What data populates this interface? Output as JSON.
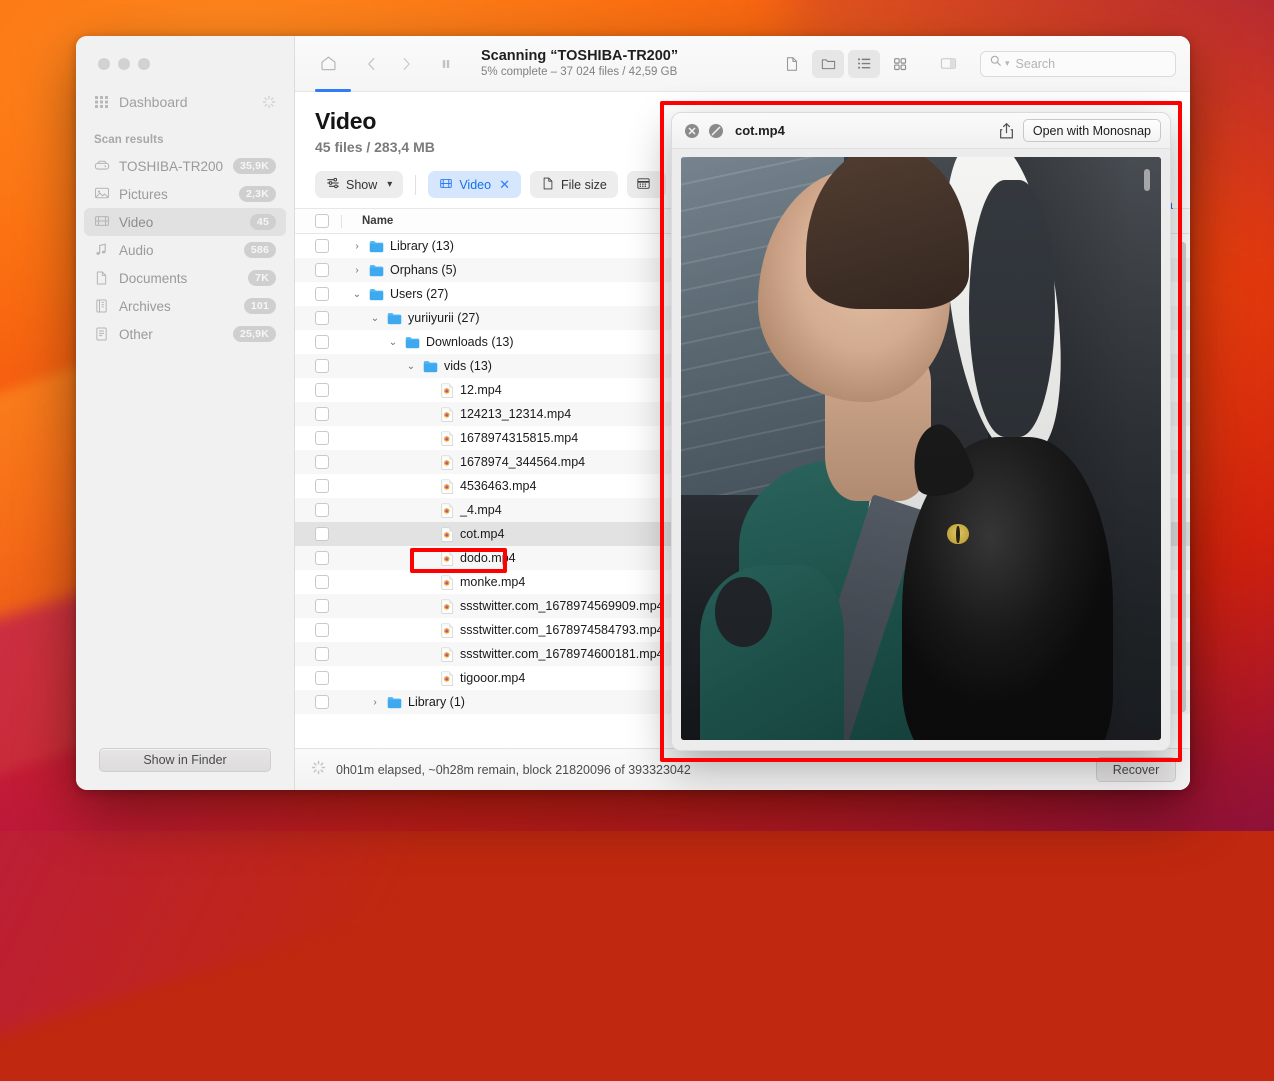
{
  "window": {
    "traffic_lights": [
      "close",
      "minimize",
      "zoom"
    ]
  },
  "sidebar": {
    "dashboard": {
      "label": "Dashboard",
      "icon": "grid-icon",
      "busy_icon": "spinner-icon"
    },
    "section_title": "Scan results",
    "items": [
      {
        "label": "TOSHIBA-TR200",
        "badge": "35,9K",
        "icon": "disk-icon",
        "selected": false
      },
      {
        "label": "Pictures",
        "badge": "2,3K",
        "icon": "image-icon",
        "selected": false
      },
      {
        "label": "Video",
        "badge": "45",
        "icon": "film-icon",
        "selected": true
      },
      {
        "label": "Audio",
        "badge": "586",
        "icon": "music-note-icon",
        "selected": false
      },
      {
        "label": "Documents",
        "badge": "7K",
        "icon": "document-icon",
        "selected": false
      },
      {
        "label": "Archives",
        "badge": "101",
        "icon": "archive-icon",
        "selected": false
      },
      {
        "label": "Other",
        "badge": "25,9K",
        "icon": "other-file-icon",
        "selected": false
      }
    ],
    "footer_button": "Show in Finder"
  },
  "toolbar": {
    "home_icon": "home-icon",
    "back_icon": "chevron-left-icon",
    "forward_icon": "chevron-right-icon",
    "pause_icon": "pause-icon",
    "scan_title": "Scanning “TOSHIBA-TR200”",
    "scan_subtitle": "5% complete – 37 024 files / 42,59 GB",
    "view_buttons": [
      {
        "name": "preview-pane-toggle",
        "icon": "document-icon",
        "active": false
      },
      {
        "name": "folder-view-toggle",
        "icon": "folder-icon",
        "active": true
      },
      {
        "name": "list-view-toggle",
        "icon": "list-icon",
        "active": true
      },
      {
        "name": "grid-view-toggle",
        "icon": "grid-icon",
        "active": false
      },
      {
        "name": "sidebar-pane-toggle",
        "icon": "panel-icon",
        "active": false
      }
    ],
    "search_placeholder": "Search",
    "search_value": "",
    "search_icon": "search-icon"
  },
  "page": {
    "title": "Video",
    "subtitle": "45 files / 283,4 MB"
  },
  "filters": {
    "show": {
      "label": "Show",
      "icon": "sliders-icon",
      "chevron": "chevron-down-icon"
    },
    "chips": [
      {
        "label": "Video",
        "icon": "film-icon",
        "active": true,
        "removable": true,
        "remove_icon": "close-icon"
      },
      {
        "label": "File size",
        "icon": "document-icon",
        "active": false,
        "removable": false
      },
      {
        "label": "",
        "icon": "calendar-icon",
        "active": false,
        "removable": false
      }
    ]
  },
  "table": {
    "columns": [
      "",
      "Name"
    ],
    "rows": [
      {
        "name": "Library (13)",
        "type": "folder",
        "depth": 0,
        "expanded": false,
        "checked": false
      },
      {
        "name": "Orphans (5)",
        "type": "folder",
        "depth": 0,
        "expanded": false,
        "checked": false
      },
      {
        "name": "Users (27)",
        "type": "folder",
        "depth": 0,
        "expanded": true,
        "checked": false
      },
      {
        "name": "yuriiyurii (27)",
        "type": "folder",
        "depth": 1,
        "expanded": true,
        "checked": false
      },
      {
        "name": "Downloads (13)",
        "type": "folder",
        "depth": 2,
        "expanded": true,
        "checked": false
      },
      {
        "name": "vids (13)",
        "type": "folder",
        "depth": 3,
        "expanded": true,
        "checked": false
      },
      {
        "name": "12.mp4",
        "type": "file",
        "depth": 4,
        "checked": false
      },
      {
        "name": "124213_12314.mp4",
        "type": "file",
        "depth": 4,
        "checked": false
      },
      {
        "name": "1678974315815.mp4",
        "type": "file",
        "depth": 4,
        "checked": false
      },
      {
        "name": "1678974_344564.mp4",
        "type": "file",
        "depth": 4,
        "checked": false
      },
      {
        "name": "4536463.mp4",
        "type": "file",
        "depth": 4,
        "checked": false
      },
      {
        "name": "_4.mp4",
        "type": "file",
        "depth": 4,
        "checked": false
      },
      {
        "name": "cot.mp4",
        "type": "file",
        "depth": 4,
        "checked": false,
        "selected": true,
        "quicklook_icon": "eye-icon"
      },
      {
        "name": "dodo.mp4",
        "type": "file",
        "depth": 4,
        "checked": false
      },
      {
        "name": "monke.mp4",
        "type": "file",
        "depth": 4,
        "checked": false
      },
      {
        "name": "ssstwitter.com_1678974569909.mp4",
        "type": "file",
        "depth": 4,
        "checked": false
      },
      {
        "name": "ssstwitter.com_1678974584793.mp4",
        "type": "file",
        "depth": 4,
        "checked": false
      },
      {
        "name": "ssstwitter.com_1678974600181.mp4",
        "type": "file",
        "depth": 4,
        "checked": false
      },
      {
        "name": "tigooor.mp4",
        "type": "file",
        "depth": 4,
        "checked": false
      },
      {
        "name": "Library (1)",
        "type": "folder",
        "depth": 1,
        "expanded": false,
        "checked": false
      }
    ]
  },
  "peek_text": "a",
  "quicklook": {
    "close_icon": "close-circle-icon",
    "block_icon": "no-entry-circle-icon",
    "title": "cot.mp4",
    "share_icon": "share-icon",
    "open_button": "Open with Monosnap",
    "media_description": "Video still: man in green scrubs driving a car with a black cat perched on his shoulder"
  },
  "statusbar": {
    "spinner_icon": "spinner-icon",
    "text": "0h01m elapsed, ~0h28m remain, block 21820096 of 393323042",
    "recover_button": "Recover"
  },
  "colors": {
    "accent_blue": "#2f7df6",
    "chip_blue_bg": "#d6e7fd",
    "chip_blue_fg": "#1571eb",
    "annotation_red": "#fe0000",
    "folder_blue": "#48b3f3",
    "selection_gray": "#e3e2e2"
  }
}
